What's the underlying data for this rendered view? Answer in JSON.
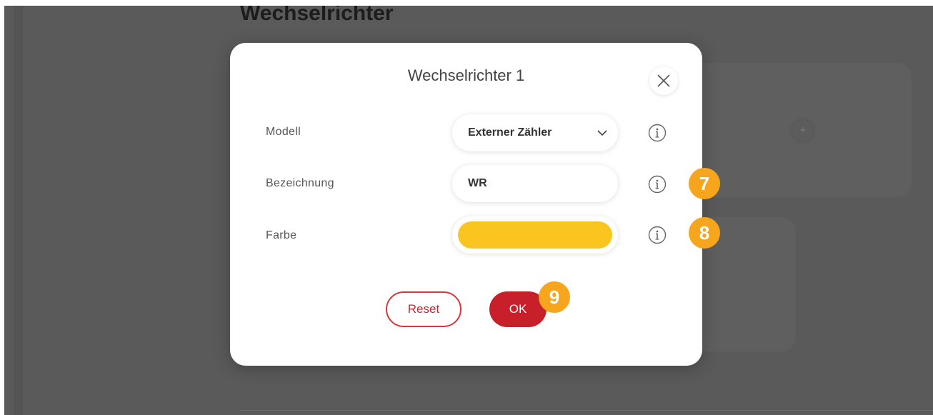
{
  "background": {
    "page_title": "Wechselrichter",
    "add_icon_glyph": "+"
  },
  "dialog": {
    "title": "Wechselrichter 1",
    "close_icon": "close-icon",
    "fields": {
      "modell": {
        "label": "Modell",
        "value": "Externer Zähler"
      },
      "bezeichnung": {
        "label": "Bezeichnung",
        "value": "WR"
      },
      "farbe": {
        "label": "Farbe",
        "color": "#fbc51f"
      }
    },
    "buttons": {
      "reset": "Reset",
      "ok": "OK"
    }
  },
  "markers": [
    "7",
    "8",
    "9"
  ],
  "colors": {
    "accent_red": "#c8202a",
    "marker_orange": "#f7a51c",
    "overlay": "#5a5a5a"
  }
}
